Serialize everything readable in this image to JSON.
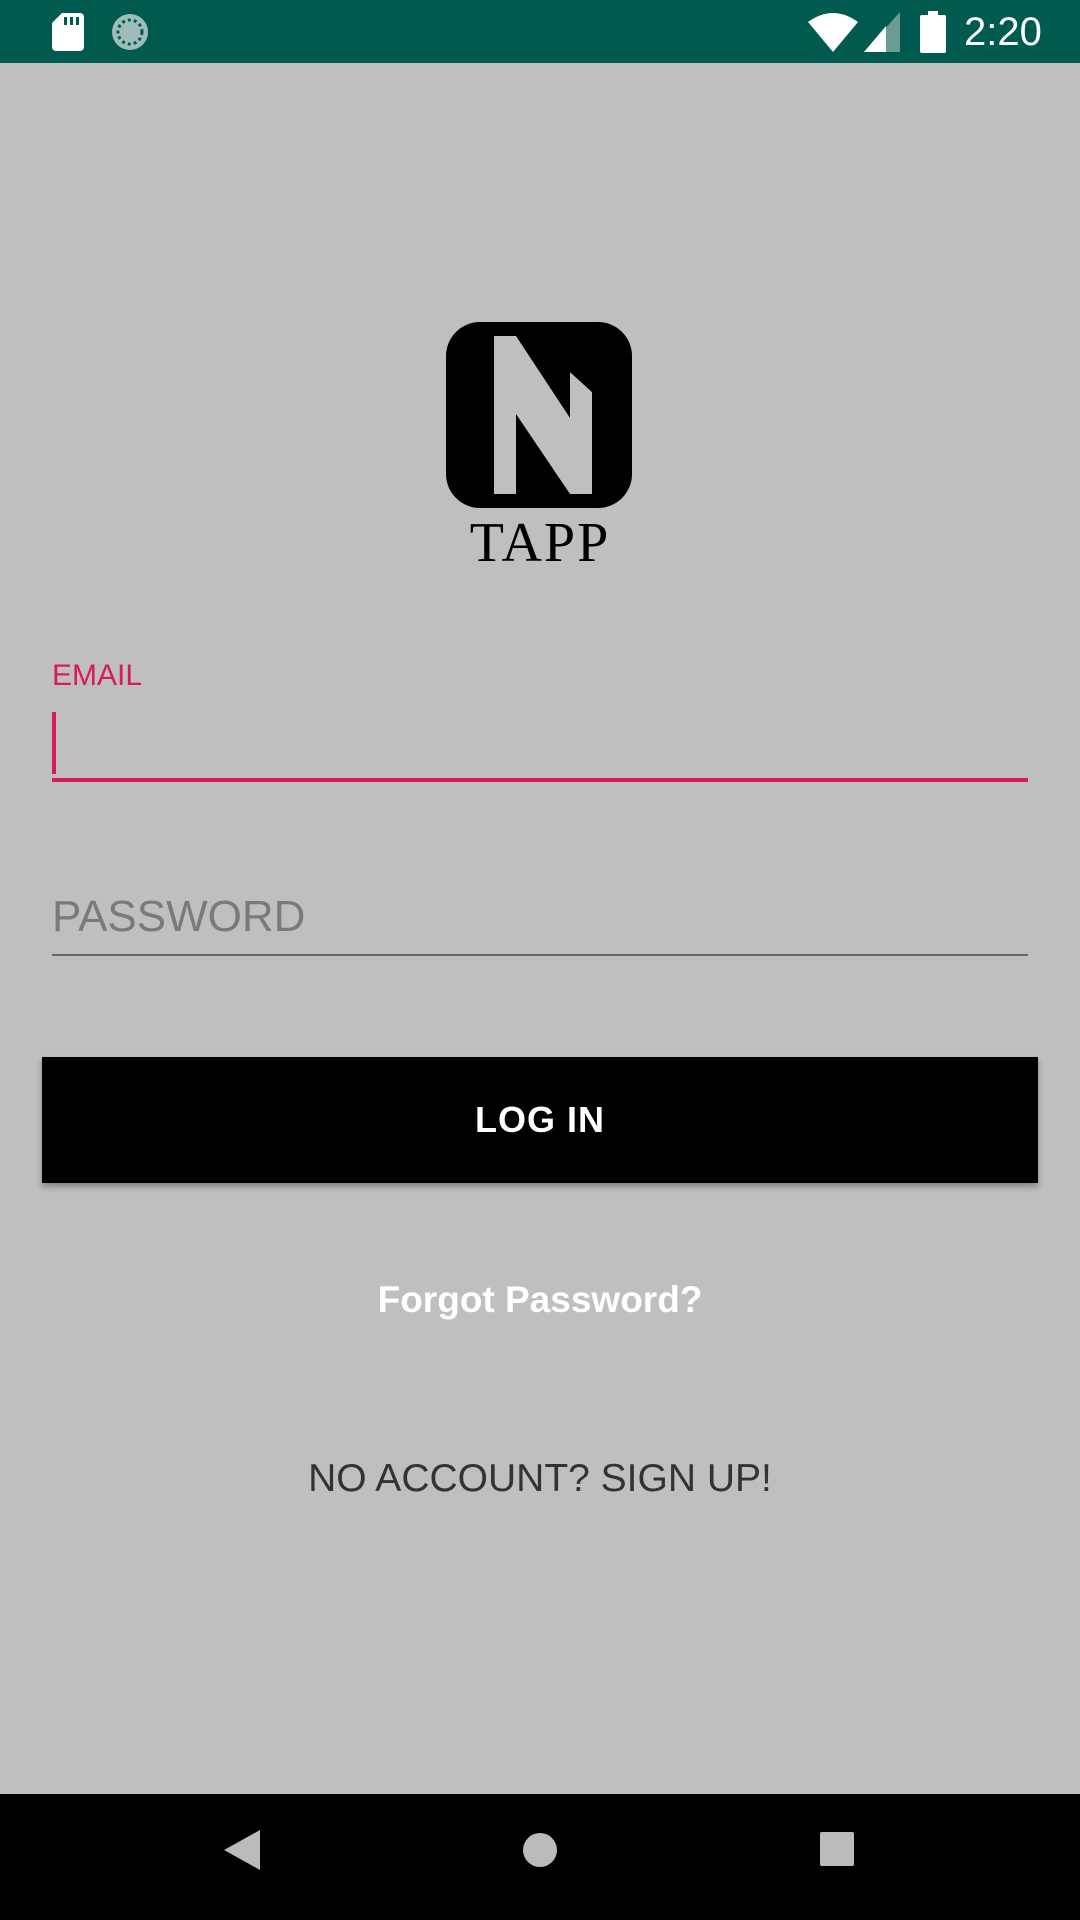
{
  "status_bar": {
    "time": "2:20",
    "icons": [
      "sd-card-icon",
      "sync-icon",
      "wifi-icon",
      "cell-signal-icon",
      "battery-icon"
    ]
  },
  "brand": {
    "logo_icon": "nfc-n-logo-icon",
    "name": "TAPP"
  },
  "email": {
    "label": "EMAIL",
    "value": "",
    "accent_color": "#d81b60"
  },
  "password": {
    "placeholder": "PASSWORD",
    "value": ""
  },
  "login_button": {
    "label": "LOG IN"
  },
  "forgot_password": {
    "label": "Forgot Password?"
  },
  "signup": {
    "label": "NO ACCOUNT? SIGN UP!"
  },
  "nav_bar": {
    "icons": [
      "back-icon",
      "home-icon",
      "recents-icon"
    ]
  },
  "colors": {
    "status_bar": "#005a50",
    "background": "#bfbfbf",
    "button": "#000000",
    "accent": "#d81b60"
  }
}
